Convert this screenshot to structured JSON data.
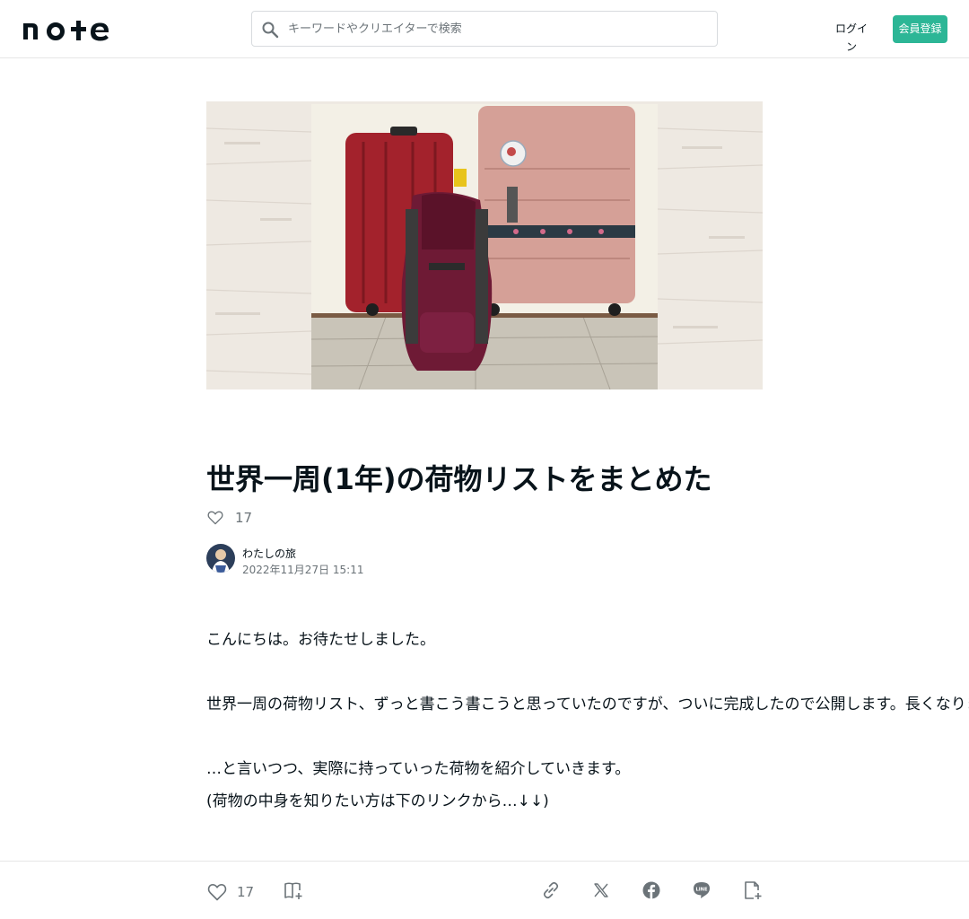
{
  "header": {
    "logo_text": "note",
    "search_placeholder": "キーワードやクリエイターで検索",
    "login_label": "ログイン",
    "signup_label": "会員登録",
    "accent_color": "#2cb696"
  },
  "hero": {
    "image_name": "suitcases-and-backpack-photo"
  },
  "article": {
    "title": "世界一周(1年)の荷物リストをまとめた",
    "like_count": "17",
    "author_name": "わたしの旅",
    "date": "2022年11月27日 15:11",
    "paragraphs": [
      "こんにちは。お待たせしました。",
      "世界一周の荷物リスト、ずっと書こう書こうと思っていたのですが、ついに完成したので公開します。長くなります。",
      "…と言いつつ、実際に持っていった荷物を紹介していきます。",
      "(荷物の中身を知りたい方は下のリンクから…↓↓)"
    ]
  },
  "footer": {
    "like_count": "17",
    "icons": [
      "magazine-add-icon",
      "link-icon",
      "x-icon",
      "facebook-icon",
      "line-icon",
      "embed-icon"
    ]
  }
}
